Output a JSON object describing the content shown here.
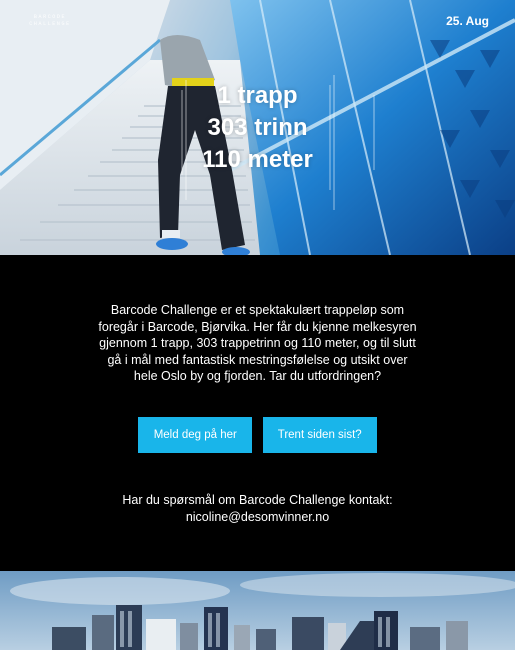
{
  "header": {
    "logo_text": "BARCODE CHALLENGE",
    "date": "25. Aug"
  },
  "hero": {
    "line1": "1 trapp",
    "line2": "303 trinn",
    "line3": "110 meter"
  },
  "intro": {
    "text": "Barcode Challenge er et spektakulært trappeløp som foregår i Barcode, Bjørvika. Her får du kjenne melkesyren gjennom 1 trapp, 303 trappetrinn og 110 meter, og til slutt gå i mål med fantastisk mestringsfølelse og utsikt over hele Oslo by og fjorden. Tar du utfordringen?"
  },
  "buttons": {
    "register_label": "Meld deg på her",
    "trained_label": "Trent siden sist?"
  },
  "contact": {
    "question": "Har du spørsmål om Barcode Challenge kontakt:",
    "email": "nicoline@desomvinner.no"
  },
  "colors": {
    "accent": "#19b5ea",
    "background": "#000000"
  }
}
